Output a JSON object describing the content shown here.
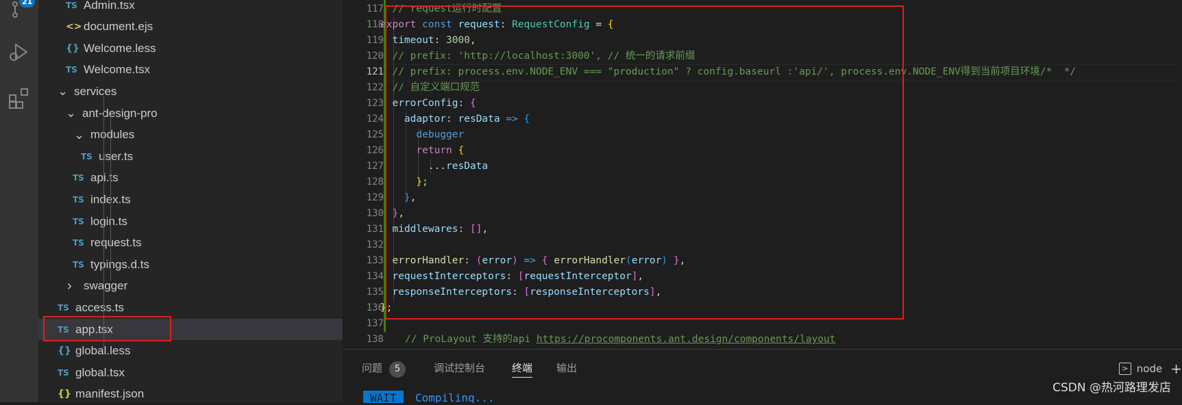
{
  "activity_bar": {
    "items": [
      {
        "icon": "source-control-icon",
        "badge": "21"
      },
      {
        "icon": "run-debug-icon"
      },
      {
        "icon": "extensions-icon"
      }
    ]
  },
  "explorer": {
    "items": [
      {
        "label": "Admin.tsx",
        "icon": "TS",
        "kind": "ts"
      },
      {
        "label": "document.ejs",
        "icon": "<>",
        "kind": "ejs"
      },
      {
        "label": "Welcome.less",
        "icon": "{}",
        "kind": "less"
      },
      {
        "label": "Welcome.tsx",
        "icon": "TS",
        "kind": "ts"
      },
      {
        "label": "services",
        "icon": "chevron-down",
        "kind": "folder"
      },
      {
        "label": "ant-design-pro",
        "icon": "chevron-down",
        "kind": "folder"
      },
      {
        "label": "modules",
        "icon": "chevron-down",
        "kind": "folder"
      },
      {
        "label": "user.ts",
        "icon": "TS",
        "kind": "ts"
      },
      {
        "label": "api.ts",
        "icon": "TS",
        "kind": "ts"
      },
      {
        "label": "index.ts",
        "icon": "TS",
        "kind": "ts"
      },
      {
        "label": "login.ts",
        "icon": "TS",
        "kind": "ts"
      },
      {
        "label": "request.ts",
        "icon": "TS",
        "kind": "ts"
      },
      {
        "label": "typings.d.ts",
        "icon": "TS",
        "kind": "ts"
      },
      {
        "label": "swagger",
        "icon": "chevron-right",
        "kind": "folder"
      },
      {
        "label": "access.ts",
        "icon": "TS",
        "kind": "ts"
      },
      {
        "label": "app.tsx",
        "icon": "TS",
        "kind": "ts",
        "selected": true
      },
      {
        "label": "global.less",
        "icon": "{}",
        "kind": "less"
      },
      {
        "label": "global.tsx",
        "icon": "TS",
        "kind": "ts"
      },
      {
        "label": "manifest.json",
        "icon": "{}",
        "kind": "json"
      }
    ]
  },
  "editor": {
    "active_line": "121",
    "lines": [
      {
        "n": "117",
        "tokens": [
          [
            "com",
            "  // request运行时配置"
          ]
        ]
      },
      {
        "n": "118",
        "tokens": [
          [
            "kw2",
            "export"
          ],
          [
            "",
            " "
          ],
          [
            "kw",
            "const"
          ],
          [
            "",
            " "
          ],
          [
            "var",
            "request"
          ],
          [
            "",
            ": "
          ],
          [
            "type",
            "RequestConfig"
          ],
          [
            "",
            " = "
          ],
          [
            "b1",
            "{"
          ]
        ]
      },
      {
        "n": "119",
        "tokens": [
          [
            "",
            "  "
          ],
          [
            "var",
            "timeout"
          ],
          [
            "",
            ": "
          ],
          [
            "num",
            "3000"
          ],
          [
            "",
            ","
          ]
        ]
      },
      {
        "n": "120",
        "tokens": [
          [
            "com",
            "  // prefix: 'http://localhost:3000', // 统一的请求前缀"
          ]
        ]
      },
      {
        "n": "121",
        "tokens": [
          [
            "com",
            "  // prefix: process.env.NODE_ENV === \"production\" ? config.baseurl :'api/', process.env.NODE_ENV得到当前项目环境/*  */"
          ]
        ]
      },
      {
        "n": "122",
        "tokens": [
          [
            "com",
            "  // 自定义端口规范"
          ]
        ]
      },
      {
        "n": "123",
        "tokens": [
          [
            "",
            "  "
          ],
          [
            "var",
            "errorConfig"
          ],
          [
            "",
            ": "
          ],
          [
            "b2",
            "{"
          ]
        ]
      },
      {
        "n": "124",
        "tokens": [
          [
            "",
            "    "
          ],
          [
            "var",
            "adaptor"
          ],
          [
            "",
            ": "
          ],
          [
            "var",
            "resData"
          ],
          [
            "",
            " "
          ],
          [
            "kw",
            "=>"
          ],
          [
            "",
            " "
          ],
          [
            "b3",
            "{"
          ]
        ]
      },
      {
        "n": "125",
        "tokens": [
          [
            "",
            "      "
          ],
          [
            "kw",
            "debugger"
          ]
        ]
      },
      {
        "n": "126",
        "tokens": [
          [
            "",
            "      "
          ],
          [
            "kw2",
            "return"
          ],
          [
            "",
            " "
          ],
          [
            "b1",
            "{"
          ]
        ]
      },
      {
        "n": "127",
        "tokens": [
          [
            "",
            "        ..."
          ],
          [
            "var",
            "resData"
          ]
        ]
      },
      {
        "n": "128",
        "tokens": [
          [
            "",
            "      "
          ],
          [
            "b1",
            "}"
          ],
          [
            "",
            ";"
          ]
        ]
      },
      {
        "n": "129",
        "tokens": [
          [
            "",
            "    "
          ],
          [
            "b3",
            "}"
          ],
          [
            "",
            ","
          ]
        ]
      },
      {
        "n": "130",
        "tokens": [
          [
            "",
            "  "
          ],
          [
            "b2",
            "}"
          ],
          [
            "",
            ","
          ]
        ]
      },
      {
        "n": "131",
        "tokens": [
          [
            "",
            "  "
          ],
          [
            "var",
            "middlewares"
          ],
          [
            "",
            ": "
          ],
          [
            "b2",
            "[]"
          ],
          [
            "",
            ","
          ]
        ]
      },
      {
        "n": "132",
        "tokens": []
      },
      {
        "n": "133",
        "tokens": [
          [
            "",
            "  "
          ],
          [
            "fn",
            "errorHandler"
          ],
          [
            "",
            ": "
          ],
          [
            "b2",
            "("
          ],
          [
            "var",
            "error"
          ],
          [
            "b2",
            ")"
          ],
          [
            "",
            " "
          ],
          [
            "kw",
            "=>"
          ],
          [
            "",
            " "
          ],
          [
            "b2",
            "{"
          ],
          [
            "",
            " "
          ],
          [
            "fn",
            "errorHandler"
          ],
          [
            "b3",
            "("
          ],
          [
            "var",
            "error"
          ],
          [
            "b3",
            ")"
          ],
          [
            "",
            " "
          ],
          [
            "b2",
            "}"
          ],
          [
            "",
            ","
          ]
        ]
      },
      {
        "n": "134",
        "tokens": [
          [
            "",
            "  "
          ],
          [
            "var",
            "requestInterceptors"
          ],
          [
            "",
            ": "
          ],
          [
            "b2",
            "["
          ],
          [
            "var",
            "requestInterceptor"
          ],
          [
            "b2",
            "]"
          ],
          [
            "",
            ","
          ]
        ]
      },
      {
        "n": "135",
        "tokens": [
          [
            "",
            "  "
          ],
          [
            "var",
            "responseInterceptors"
          ],
          [
            "",
            ": "
          ],
          [
            "b2",
            "["
          ],
          [
            "var",
            "responseInterceptors"
          ],
          [
            "b2",
            "]"
          ],
          [
            "",
            ","
          ]
        ]
      },
      {
        "n": "136",
        "tokens": [
          [
            "b1",
            "}"
          ],
          [
            "",
            ";"
          ]
        ]
      },
      {
        "n": "137",
        "tokens": []
      },
      {
        "n": "138",
        "tokens": [
          [
            "com",
            "// ProLayout 支持的api "
          ],
          [
            "link",
            "https://procomponents.ant.design/components/layout"
          ]
        ]
      }
    ]
  },
  "panel": {
    "tabs": [
      {
        "label": "问题",
        "count": "5"
      },
      {
        "label": "调试控制台"
      },
      {
        "label": "终端",
        "active": true
      },
      {
        "label": "输出"
      }
    ],
    "terminal_name": "node",
    "status_badge": "WAIT",
    "status_text": "Compiling..."
  },
  "watermark": "CSDN @热河路理发店",
  "colors": {
    "highlight_box": "#e02020",
    "accent": "#0078d4"
  }
}
